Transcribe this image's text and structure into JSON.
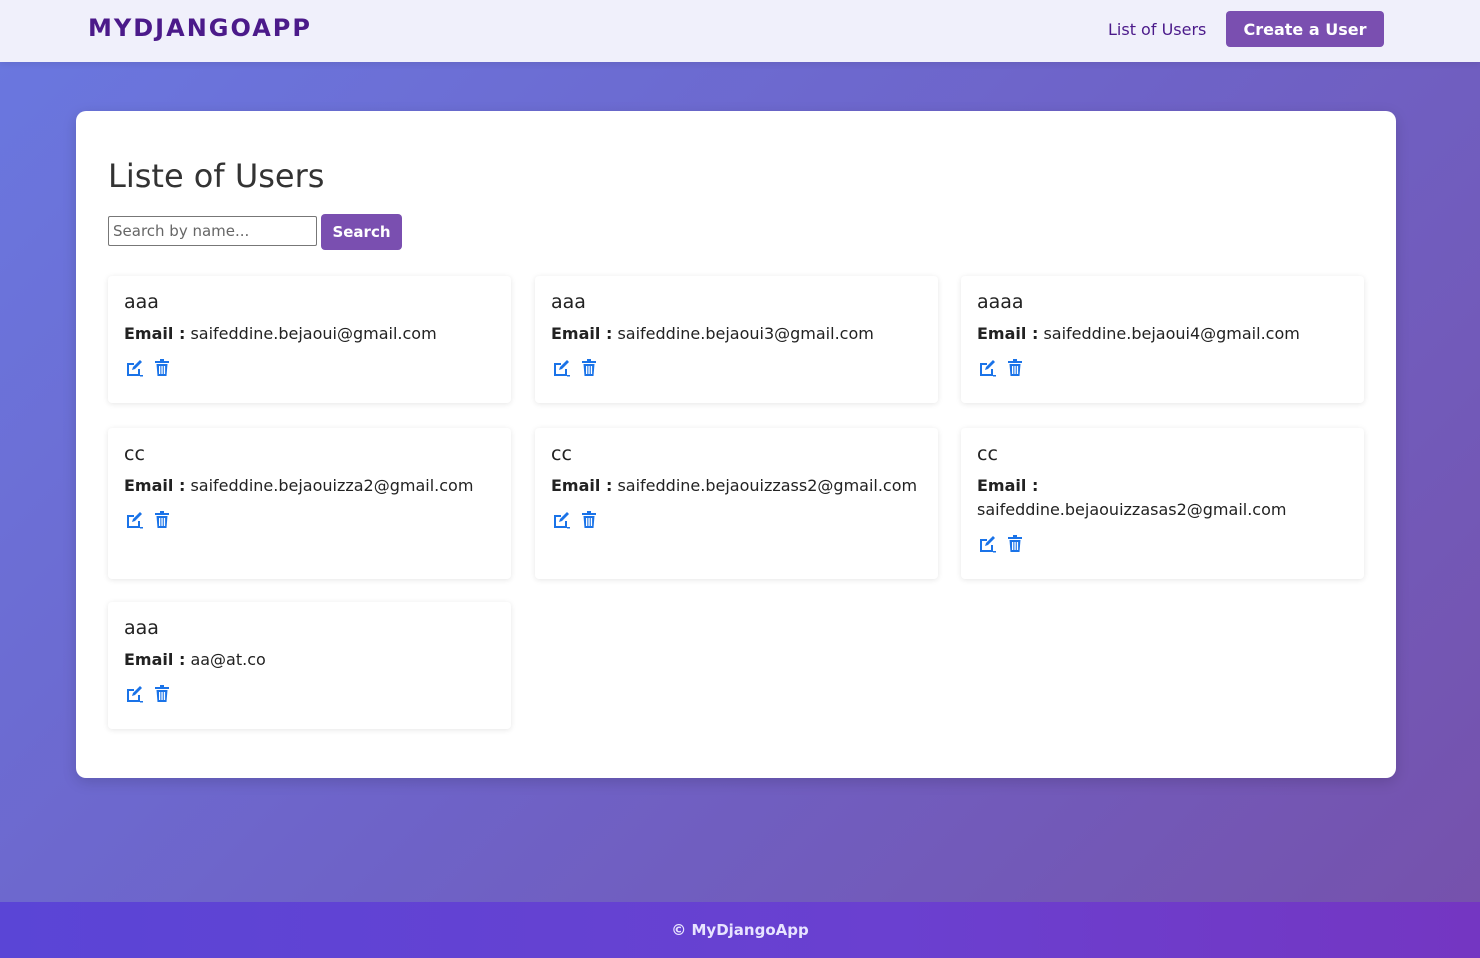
{
  "navbar": {
    "brand": "MYDJANGOAPP",
    "link_users": "List of Users",
    "create_button": "Create a User"
  },
  "main": {
    "title": "Liste of Users",
    "search": {
      "placeholder": "Search by name...",
      "value": "",
      "button": "Search"
    },
    "email_label": "Email :",
    "users": [
      {
        "name": "aaa",
        "email": "saifeddine.bejaoui@gmail.com"
      },
      {
        "name": "aaa",
        "email": "saifeddine.bejaoui3@gmail.com"
      },
      {
        "name": "aaaa",
        "email": "saifeddine.bejaoui4@gmail.com"
      },
      {
        "name": "cc",
        "email": "saifeddine.bejaouizza2@gmail.com"
      },
      {
        "name": "cc",
        "email": "saifeddine.bejaouizzass2@gmail.com"
      },
      {
        "name": "cc",
        "email": "saifeddine.bejaouizzasas2@gmail.com"
      },
      {
        "name": "aaa",
        "email": "aa@at.co"
      }
    ]
  },
  "icons": {
    "edit": "edit-icon",
    "delete": "trash-icon"
  },
  "colors": {
    "brand": "#4b1a8a",
    "button": "#7a4fb0",
    "icon": "#1a73e8"
  },
  "footer": {
    "text": "© MyDjangoApp"
  }
}
